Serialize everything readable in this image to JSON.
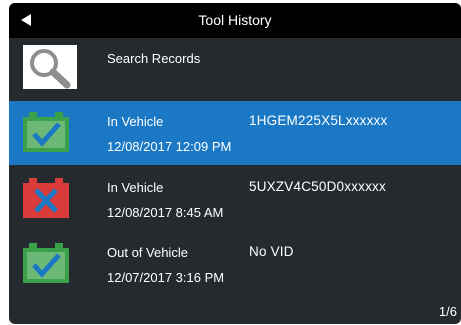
{
  "header": {
    "title": "Tool History"
  },
  "search": {
    "label": "Search Records"
  },
  "records": [
    {
      "status": "In Vehicle",
      "vin": "1HGEM225X5Lxxxxxx",
      "date": "12/08/2017  12:09 PM",
      "result": "pass",
      "selected": true
    },
    {
      "status": "In Vehicle",
      "vin": "5UXZV4C50D0xxxxxx",
      "date": "12/08/2017  8:45 AM",
      "result": "fail",
      "selected": false
    },
    {
      "status": "Out of Vehicle",
      "vin": "No VID",
      "date": "12/07/2017  3:16 PM",
      "result": "pass",
      "selected": false
    }
  ],
  "pagination": {
    "label": "1/6"
  },
  "colors": {
    "background": "#252a2f",
    "header": "#000000",
    "selected": "#1b78c4",
    "pass": "#3aa14a",
    "fail": "#d93b3b",
    "check": "#1b78c4"
  },
  "icons": {
    "back": "back-arrow-icon",
    "search": "magnifier-icon",
    "pass": "battery-check-icon",
    "fail": "battery-x-icon"
  }
}
